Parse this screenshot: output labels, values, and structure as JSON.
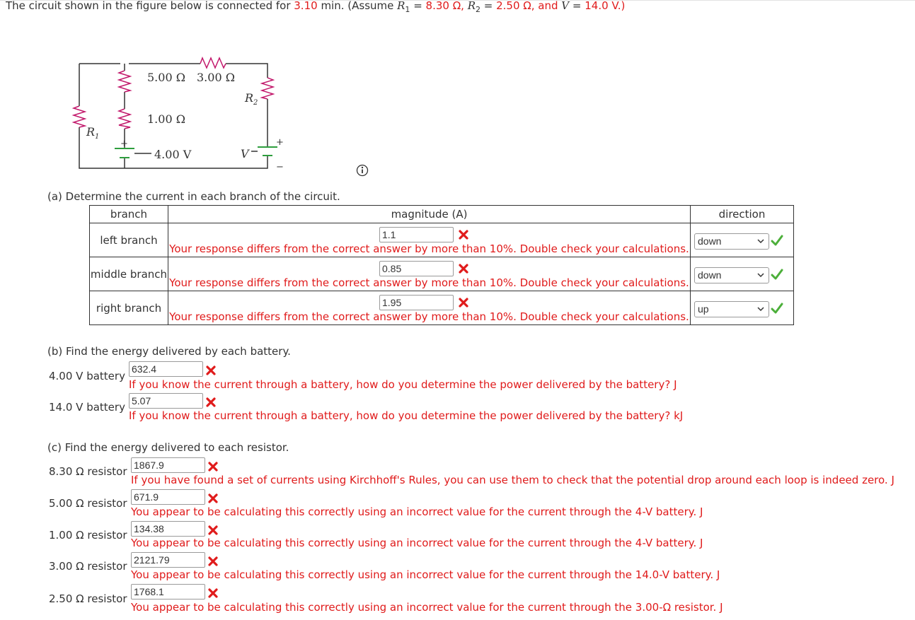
{
  "question": {
    "prefix": "The circuit shown in the figure below is connected for ",
    "time": "3.10",
    "time_unit": " min. (Assume ",
    "r1_label": "R",
    "r1_sub": "1",
    "eq1": " = ",
    "r1_value": "8.30",
    "r1_unit": " Ω, ",
    "r2_label": "R",
    "r2_sub": "2",
    "eq2": " = ",
    "r2_value": "2.50",
    "r2_unit": " Ω, and ",
    "v_label": "V",
    "eq3": " = ",
    "v_value": "14.0",
    "v_unit": " V.)"
  },
  "circuit": {
    "r_top_left": "5.00 Ω",
    "r_top_right": "3.00 Ω",
    "r_middle": "1.00 Ω",
    "battery_left": "4.00 V",
    "r1": "R",
    "r1_sub": "1",
    "r2": "R",
    "r2_sub": "2",
    "v": "V",
    "plus": "+",
    "minus": "−"
  },
  "part_a": {
    "title": "(a) Determine the current in each branch of the circuit.",
    "headers": [
      "branch",
      "magnitude (A)",
      "direction"
    ],
    "rows": [
      {
        "branch": "left branch",
        "value": "1.1",
        "feedback": "Your response differs from the correct answer by more than 10%. Double check your calculations.",
        "direction": "down"
      },
      {
        "branch": "middle branch",
        "value": "0.85",
        "feedback": "Your response differs from the correct answer by more than 10%. Double check your calculations.",
        "direction": "down"
      },
      {
        "branch": "right branch",
        "value": "1.95",
        "feedback": "Your response differs from the correct answer by more than 10%. Double check your calculations.",
        "direction": "up"
      }
    ]
  },
  "part_b": {
    "title": "(b) Find the energy delivered by each battery.",
    "rows": [
      {
        "label": "4.00 V battery",
        "value": "632.4",
        "feedback": "If you know the current through a battery, how do you determine the power delivered by the battery? J"
      },
      {
        "label": "14.0 V battery",
        "value": "5.07",
        "feedback": "If you know the current through a battery, how do you determine the power delivered by the battery? kJ"
      }
    ]
  },
  "part_c": {
    "title": "(c) Find the energy delivered to each resistor.",
    "rows": [
      {
        "label": "8.30 Ω resistor",
        "value": "1867.9",
        "feedback": "If you have found a set of currents using Kirchhoff's Rules, you can use them to check that the potential drop around each loop is indeed zero. J"
      },
      {
        "label": "5.00 Ω resistor",
        "value": "671.9",
        "feedback": "You appear to be calculating this correctly using an incorrect value for the current through the 4-V battery. J"
      },
      {
        "label": "1.00 Ω resistor",
        "value": "134.38",
        "feedback": "You appear to be calculating this correctly using an incorrect value for the current through the 4-V battery. J"
      },
      {
        "label": "3.00 Ω resistor",
        "value": "2121.79",
        "feedback": "You appear to be calculating this correctly using an incorrect value for the current through the 14.0-V battery. J"
      },
      {
        "label": "2.50 Ω resistor",
        "value": "1768.1",
        "feedback": "You appear to be calculating this correctly using an incorrect value for the current through the 3.00-Ω resistor. J"
      }
    ]
  },
  "colors": {
    "accent_red": "#e01b1b",
    "correct_green": "#4caf3a"
  }
}
